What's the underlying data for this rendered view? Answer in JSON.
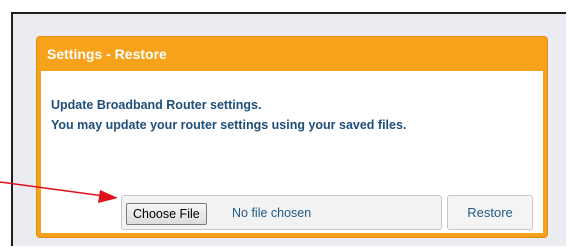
{
  "panel": {
    "title": "Settings - Restore",
    "description_line1": "Update Broadband Router settings.",
    "description_line2": "You may update your router settings using your saved files."
  },
  "file_input": {
    "button_label": "Choose File",
    "status_text": "No file chosen"
  },
  "restore_button": {
    "label": "Restore"
  },
  "colors": {
    "panel_header": "#f7a21b",
    "text_blue": "#1f4e79",
    "annotation_arrow": "#e0101a"
  },
  "icons": {
    "annotation": "arrow-pointer-icon"
  }
}
